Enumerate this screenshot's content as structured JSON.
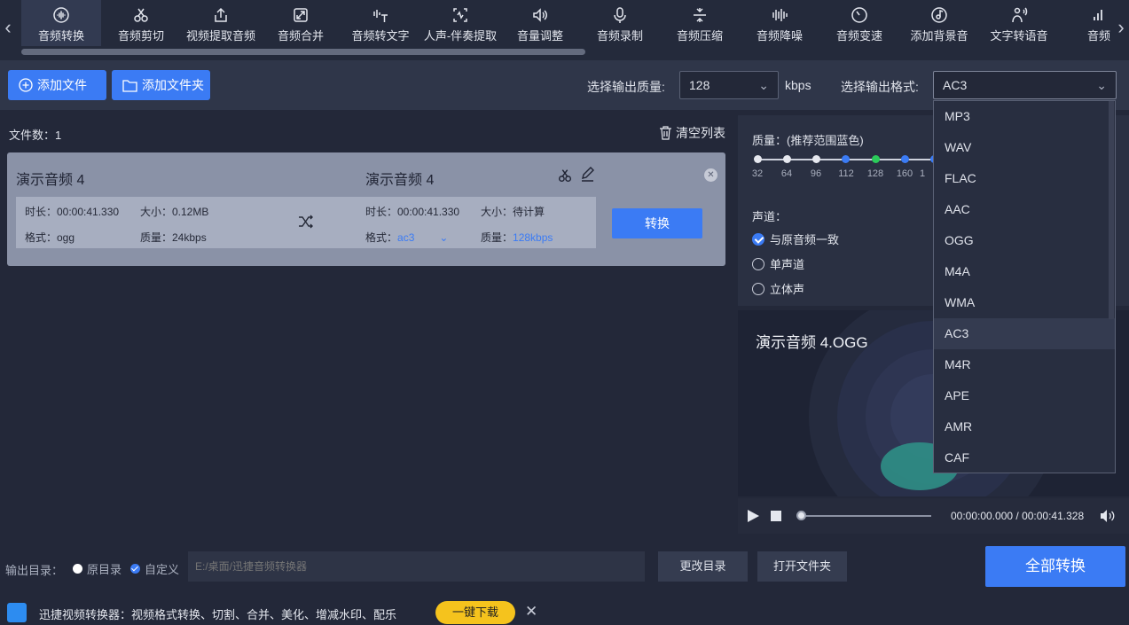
{
  "nav": {
    "items": [
      {
        "label": "音频转换",
        "icon": "wave-circle-icon",
        "active": true
      },
      {
        "label": "音频剪切",
        "icon": "scissors-icon"
      },
      {
        "label": "视频提取音频",
        "icon": "upload-box-icon"
      },
      {
        "label": "音频合并",
        "icon": "merge-box-icon"
      },
      {
        "label": "音频转文字",
        "icon": "wave-text-icon"
      },
      {
        "label": "人声-伴奏提取",
        "icon": "voice-extract-icon"
      },
      {
        "label": "音量调整",
        "icon": "speaker-icon"
      },
      {
        "label": "音频录制",
        "icon": "microphone-icon"
      },
      {
        "label": "音频压缩",
        "icon": "compress-icon"
      },
      {
        "label": "音频降噪",
        "icon": "bars-icon"
      },
      {
        "label": "音频变速",
        "icon": "speedometer-icon"
      },
      {
        "label": "添加背景音",
        "icon": "music-disc-icon"
      },
      {
        "label": "文字转语音",
        "icon": "text-speech-icon"
      },
      {
        "label": "音频",
        "icon": "chart-icon"
      }
    ]
  },
  "toolbar": {
    "add_file": "添加文件",
    "add_folder": "添加文件夹",
    "quality_label": "选择输出质量:",
    "quality_value": "128",
    "quality_unit": "kbps",
    "format_label": "选择输出格式:",
    "format_value": "AC3"
  },
  "file_list": {
    "count_label": "文件数：",
    "count": "1",
    "clear_label": "清空列表",
    "file": {
      "src_name": "演示音频 4",
      "dst_name": "演示音频 4",
      "src_duration": "时长：00:00:41.330",
      "src_size": "大小：0.12MB",
      "src_format": "格式：ogg",
      "src_quality": "质量：24kbps",
      "dst_duration": "时长：00:00:41.330",
      "dst_size": "大小：待计算",
      "dst_format_label": "格式：",
      "dst_format": "ac3",
      "dst_quality_label": "质量：",
      "dst_quality": "128kbps",
      "convert": "转换"
    }
  },
  "settings": {
    "quality_title": "质量：(推荐范围蓝色)",
    "quality_ticks": [
      "32",
      "64",
      "96",
      "112",
      "128",
      "160",
      "1"
    ],
    "channel_title": "声道：",
    "channels": [
      "与原音频一致",
      "单声道",
      "立体声"
    ],
    "selected_channel": 0
  },
  "preview": {
    "title": "演示音频 4.OGG",
    "time": "00:00:00.000 / 00:00:41.328",
    "progress": 0
  },
  "format_dropdown": {
    "options": [
      "MP3",
      "WAV",
      "FLAC",
      "AAC",
      "OGG",
      "M4A",
      "WMA",
      "AC3",
      "M4R",
      "APE",
      "AMR",
      "CAF"
    ],
    "selected": "AC3"
  },
  "output": {
    "label": "输出目录：",
    "option_original": "原目录",
    "option_custom": "自定义",
    "path_placeholder": "E:/桌面/迅捷音频转换器",
    "change_dir": "更改目录",
    "open_folder": "打开文件夹",
    "convert_all": "全部转换"
  },
  "ad": {
    "text": "迅捷视频转换器：视频格式转换、切割、合并、美化、增减水印、配乐",
    "button": "一键下载",
    "close": "✕"
  },
  "colors": {
    "accent": "#3b7bf4",
    "background": "#232839",
    "ad_button": "#f5c31d"
  }
}
